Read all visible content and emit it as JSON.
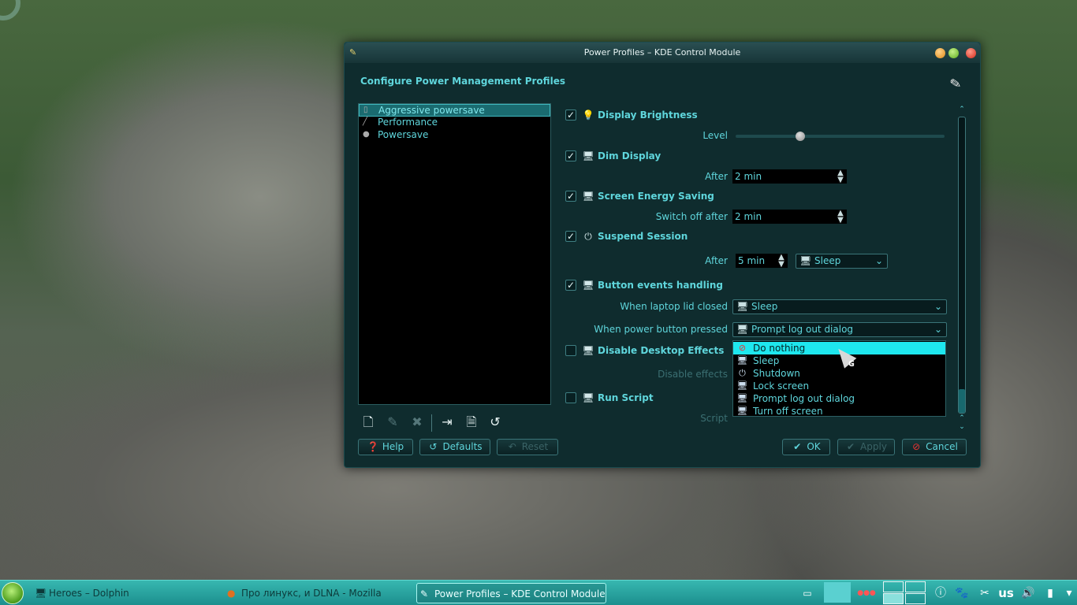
{
  "window": {
    "title": "Power Profiles – KDE Control Module",
    "header": "Configure Power Management Profiles"
  },
  "profiles": [
    {
      "label": "Aggressive powersave",
      "icon": "lightbulb-icon",
      "selected": true
    },
    {
      "label": "Performance",
      "icon": "wand-icon",
      "selected": false
    },
    {
      "label": "Powersave",
      "icon": "lightbulb-icon",
      "selected": false
    }
  ],
  "sections": {
    "brightness": {
      "title": "Display Brightness",
      "checked": true,
      "level_label": "Level",
      "level_fraction": 0.31
    },
    "dim": {
      "title": "Dim Display",
      "checked": true,
      "after_label": "After",
      "after_value": "2 min"
    },
    "energy": {
      "title": "Screen Energy Saving",
      "checked": true,
      "label": "Switch off after",
      "value": "2 min"
    },
    "suspend": {
      "title": "Suspend Session",
      "checked": true,
      "after_label": "After",
      "after_value": "5 min",
      "action": "Sleep"
    },
    "buttons": {
      "title": "Button events handling",
      "checked": true,
      "lid_label": "When laptop lid closed",
      "lid_value": "Sleep",
      "power_label": "When power button pressed",
      "power_value": "Prompt log out dialog"
    },
    "effects": {
      "title": "Disable Desktop Effects",
      "checked": false,
      "label": "Disable effects"
    },
    "script": {
      "title": "Run Script",
      "checked": false,
      "label": "Script"
    }
  },
  "dropdown": {
    "options": [
      "Do nothing",
      "Sleep",
      "Shutdown",
      "Lock screen",
      "Prompt log out dialog",
      "Turn off screen"
    ],
    "highlighted": "Do nothing"
  },
  "buttons": {
    "help": "Help",
    "defaults": "Defaults",
    "reset": "Reset",
    "ok": "OK",
    "apply": "Apply",
    "cancel": "Cancel"
  },
  "taskbar": {
    "tasks": [
      "Heroes – Dolphin",
      "Про линукс, и DLNA - Mozilla Firefox",
      "Power Profiles – KDE Control Module"
    ],
    "keyboard_layout": "us"
  },
  "colors": {
    "accent": "#5fd6dc",
    "highlight": "#1ee7ee",
    "window_bg": "#0f2c2e"
  }
}
